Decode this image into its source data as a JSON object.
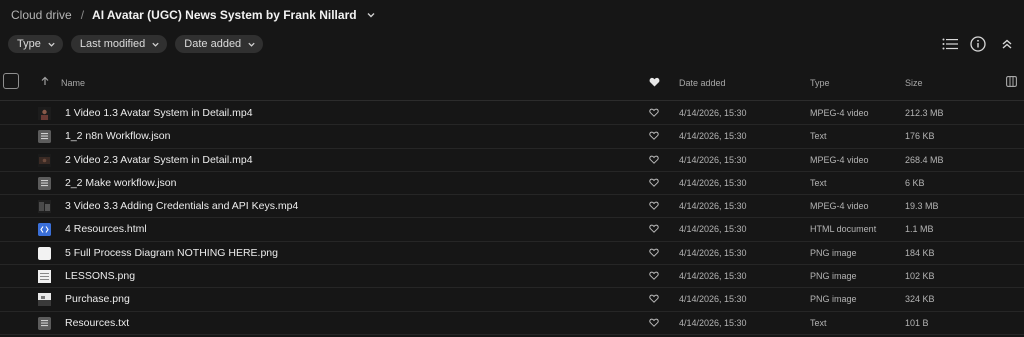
{
  "breadcrumb": {
    "root": "Cloud drive",
    "separator": "/",
    "current": "AI Avatar (UGC) News System by Frank Nillard"
  },
  "filters": [
    {
      "label": "Type"
    },
    {
      "label": "Last modified"
    },
    {
      "label": "Date added"
    }
  ],
  "toolbar": {
    "list_icon": "list-view-icon",
    "info_icon": "info-icon",
    "collapse_icon": "collapse-icon"
  },
  "table": {
    "columns": {
      "name": "Name",
      "date_added": "Date added",
      "type": "Type",
      "size": "Size"
    },
    "rows": [
      {
        "name": "1 Video 1.3 Avatar System in Detail.mp4",
        "date": "4/14/2026, 15:30",
        "type": "MPEG-4 video",
        "size": "212.3 MB",
        "thumb": "video"
      },
      {
        "name": "1_2 n8n Workflow.json",
        "date": "4/14/2026, 15:30",
        "type": "Text",
        "size": "176 KB",
        "thumb": "text"
      },
      {
        "name": "2 Video 2.3 Avatar System in Detail.mp4",
        "date": "4/14/2026, 15:30",
        "type": "MPEG-4 video",
        "size": "268.4 MB",
        "thumb": "video"
      },
      {
        "name": "2_2 Make workflow.json",
        "date": "4/14/2026, 15:30",
        "type": "Text",
        "size": "6 KB",
        "thumb": "text"
      },
      {
        "name": "3 Video 3.3 Adding Credentials and API Keys.mp4",
        "date": "4/14/2026, 15:30",
        "type": "MPEG-4 video",
        "size": "19.3 MB",
        "thumb": "video"
      },
      {
        "name": "4 Resources.html",
        "date": "4/14/2026, 15:30",
        "type": "HTML document",
        "size": "1.1 MB",
        "thumb": "html"
      },
      {
        "name": "5 Full Process Diagram NOTHING HERE.png",
        "date": "4/14/2026, 15:30",
        "type": "PNG image",
        "size": "184 KB",
        "thumb": "image"
      },
      {
        "name": "LESSONS.png",
        "date": "4/14/2026, 15:30",
        "type": "PNG image",
        "size": "102 KB",
        "thumb": "image"
      },
      {
        "name": "Purchase.png",
        "date": "4/14/2026, 15:30",
        "type": "PNG image",
        "size": "324 KB",
        "thumb": "image"
      },
      {
        "name": "Resources.txt",
        "date": "4/14/2026, 15:30",
        "type": "Text",
        "size": "101 B",
        "thumb": "text"
      }
    ]
  },
  "colors": {
    "background": "#161616",
    "chip": "#303030",
    "html_accent": "#3a6fd8"
  }
}
